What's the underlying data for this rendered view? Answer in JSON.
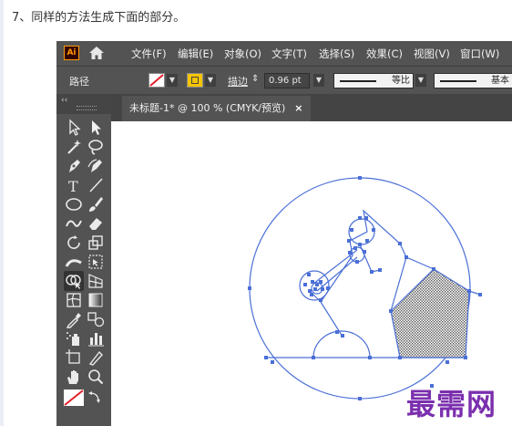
{
  "instruction": "7、同样的方法生成下面的部分。",
  "app": {
    "logo_text": "Ai"
  },
  "menubar": {
    "items": [
      "文件(F)",
      "编辑(E)",
      "对象(O)",
      "文字(T)",
      "选择(S)",
      "效果(C)",
      "视图(V)",
      "窗口(W)"
    ]
  },
  "control_bar": {
    "object_type": "路径",
    "stroke_label": "描边",
    "stroke_weight": "0.96 pt",
    "profile_label": "等比",
    "brush_label": "基本",
    "colors": {
      "stroke_slash": "#e2202a",
      "fill_swatch": "#f6c400"
    }
  },
  "document_tab": {
    "title": "未标题-1* @ 100 % (CMYK/预览)",
    "close_label": "×"
  },
  "toolbar": {
    "collapse_label": "‹‹",
    "tools": [
      "selection-tool",
      "direct-selection-tool",
      "magic-wand-tool",
      "lasso-tool",
      "pen-tool",
      "curvature-tool",
      "type-tool",
      "line-segment-tool",
      "ellipse-tool",
      "paintbrush-tool",
      "shaper-tool",
      "eraser-tool",
      "rotate-tool",
      "scale-tool",
      "width-tool",
      "free-transform-tool",
      "shape-builder-tool",
      "perspective-grid-tool",
      "mesh-tool",
      "gradient-tool",
      "eyedropper-tool",
      "blend-tool",
      "symbol-sprayer-tool",
      "column-graph-tool",
      "artboard-tool",
      "slice-tool",
      "hand-tool",
      "zoom-tool"
    ]
  },
  "canvas": {
    "selection_color": "#4a6fd6",
    "pattern_color": "#555555"
  },
  "watermark": {
    "text": "最需网",
    "color": "#7b2fae"
  }
}
